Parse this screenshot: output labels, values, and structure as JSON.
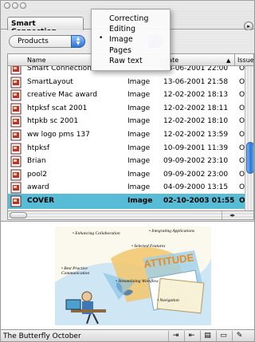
{
  "window": {
    "tab_title": "Smart Connection"
  },
  "toolbar": {
    "filter_selected": "Products"
  },
  "menu": {
    "items": [
      {
        "label": "Correcting",
        "checked": false
      },
      {
        "label": "Editing",
        "checked": false
      },
      {
        "label": "Image",
        "checked": true
      },
      {
        "label": "Pages",
        "checked": false
      },
      {
        "label": "Raw text",
        "checked": false
      }
    ],
    "check_glyph": "•"
  },
  "table": {
    "headers": {
      "name": "Name",
      "date": "Date",
      "issue": "Issue",
      "sort_glyph": "▲"
    },
    "rows": [
      {
        "name": "Smart Connection",
        "type": "",
        "date": "13-06-2001 22:00",
        "issue": "Oc",
        "selected": false
      },
      {
        "name": "SmartLayout",
        "type": "Image",
        "date": "13-06-2001 21:58",
        "issue": "Oc",
        "selected": false
      },
      {
        "name": "creative Mac award",
        "type": "Image",
        "date": "12-02-2002 18:13",
        "issue": "Oc",
        "selected": false
      },
      {
        "name": "htpksf scat 2001",
        "type": "Image",
        "date": "12-02-2002 18:11",
        "issue": "Oc",
        "selected": false
      },
      {
        "name": "htpkb sc 2001",
        "type": "Image",
        "date": "12-02-2002 18:10",
        "issue": "Oc",
        "selected": false
      },
      {
        "name": "ww logo pms 137",
        "type": "Image",
        "date": "12-02-2002 13:59",
        "issue": "Oc",
        "selected": false
      },
      {
        "name": "htpksf",
        "type": "Image",
        "date": "10-09-2001 11:39",
        "issue": "Oc",
        "selected": false
      },
      {
        "name": "Brian",
        "type": "Image",
        "date": "09-09-2002 23:10",
        "issue": "Oc",
        "selected": false
      },
      {
        "name": "pool2",
        "type": "Image",
        "date": "09-09-2002 23:00",
        "issue": "Oc",
        "selected": false
      },
      {
        "name": "award",
        "type": "Image",
        "date": "04-09-2000 13:15",
        "issue": "Oc",
        "selected": false
      },
      {
        "name": "COVER",
        "type": "Image",
        "date": "02-10-2003 01:55",
        "issue": "Oc",
        "selected": true
      }
    ]
  },
  "scroll": {
    "left_right_arrows": "◂▸",
    "vertical_position": 0.55
  },
  "preview": {
    "texts": [
      "• Enhancing Collaboration",
      "• Integrating Applications",
      "• Selected Features",
      "• Best Practice Communication",
      "• Streamlining Workflow",
      "• Navigation"
    ]
  },
  "status": {
    "label": "The Butterfly October"
  },
  "colors": {
    "selection": "#58bcd6",
    "accent_blue": "#2e74d6"
  }
}
